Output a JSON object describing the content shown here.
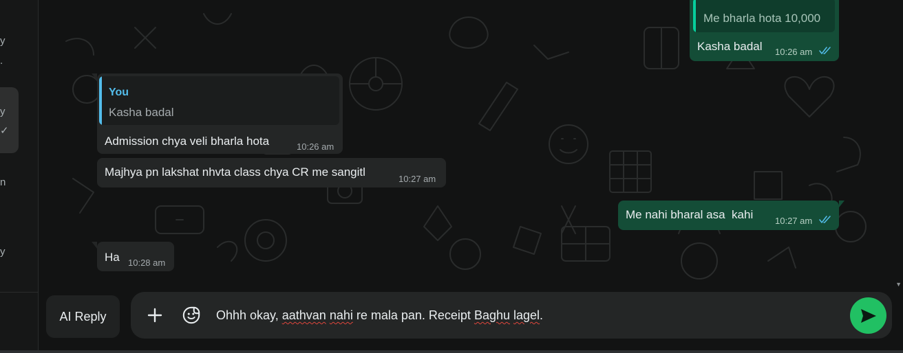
{
  "sidebar_fragments": [
    "y",
    ".",
    "y",
    "✓",
    "n",
    "y"
  ],
  "colors": {
    "accent_green": "#21c063",
    "outgoing_bubble": "#144d37",
    "incoming_bubble": "#242626",
    "quote_bar_blue": "#53bdeb",
    "quote_bar_green": "#06cf9c",
    "read_ticks": "#53bdeb"
  },
  "messages": [
    {
      "direction": "out",
      "quoted_text": "Me bharla hota 10,000",
      "text": "Kasha badal",
      "time": "10:26 am",
      "status": "read"
    },
    {
      "direction": "in",
      "quoted_author": "You",
      "quoted_text": "Kasha badal",
      "text": "Admission chya veli bharla hota",
      "time": "10:26 am"
    },
    {
      "direction": "in",
      "text": "Majhya pn lakshat nhvta class chya CR me sangitl",
      "time": "10:27 am"
    },
    {
      "direction": "out",
      "text": "Me nahi bharal asa  kahi",
      "time": "10:27 am",
      "status": "read"
    },
    {
      "direction": "in",
      "text": "Ha",
      "time": "10:28 am"
    }
  ],
  "composer": {
    "ai_reply_label": "AI Reply",
    "attach_icon": "plus-icon",
    "sticker_icon": "sticker-icon",
    "send_icon": "send-icon",
    "text_parts": [
      "Ohhh okay, ",
      "aathvan",
      " ",
      "nahi",
      " re mala pan. Receipt ",
      "Baghu",
      " ",
      "lagel",
      "."
    ]
  }
}
